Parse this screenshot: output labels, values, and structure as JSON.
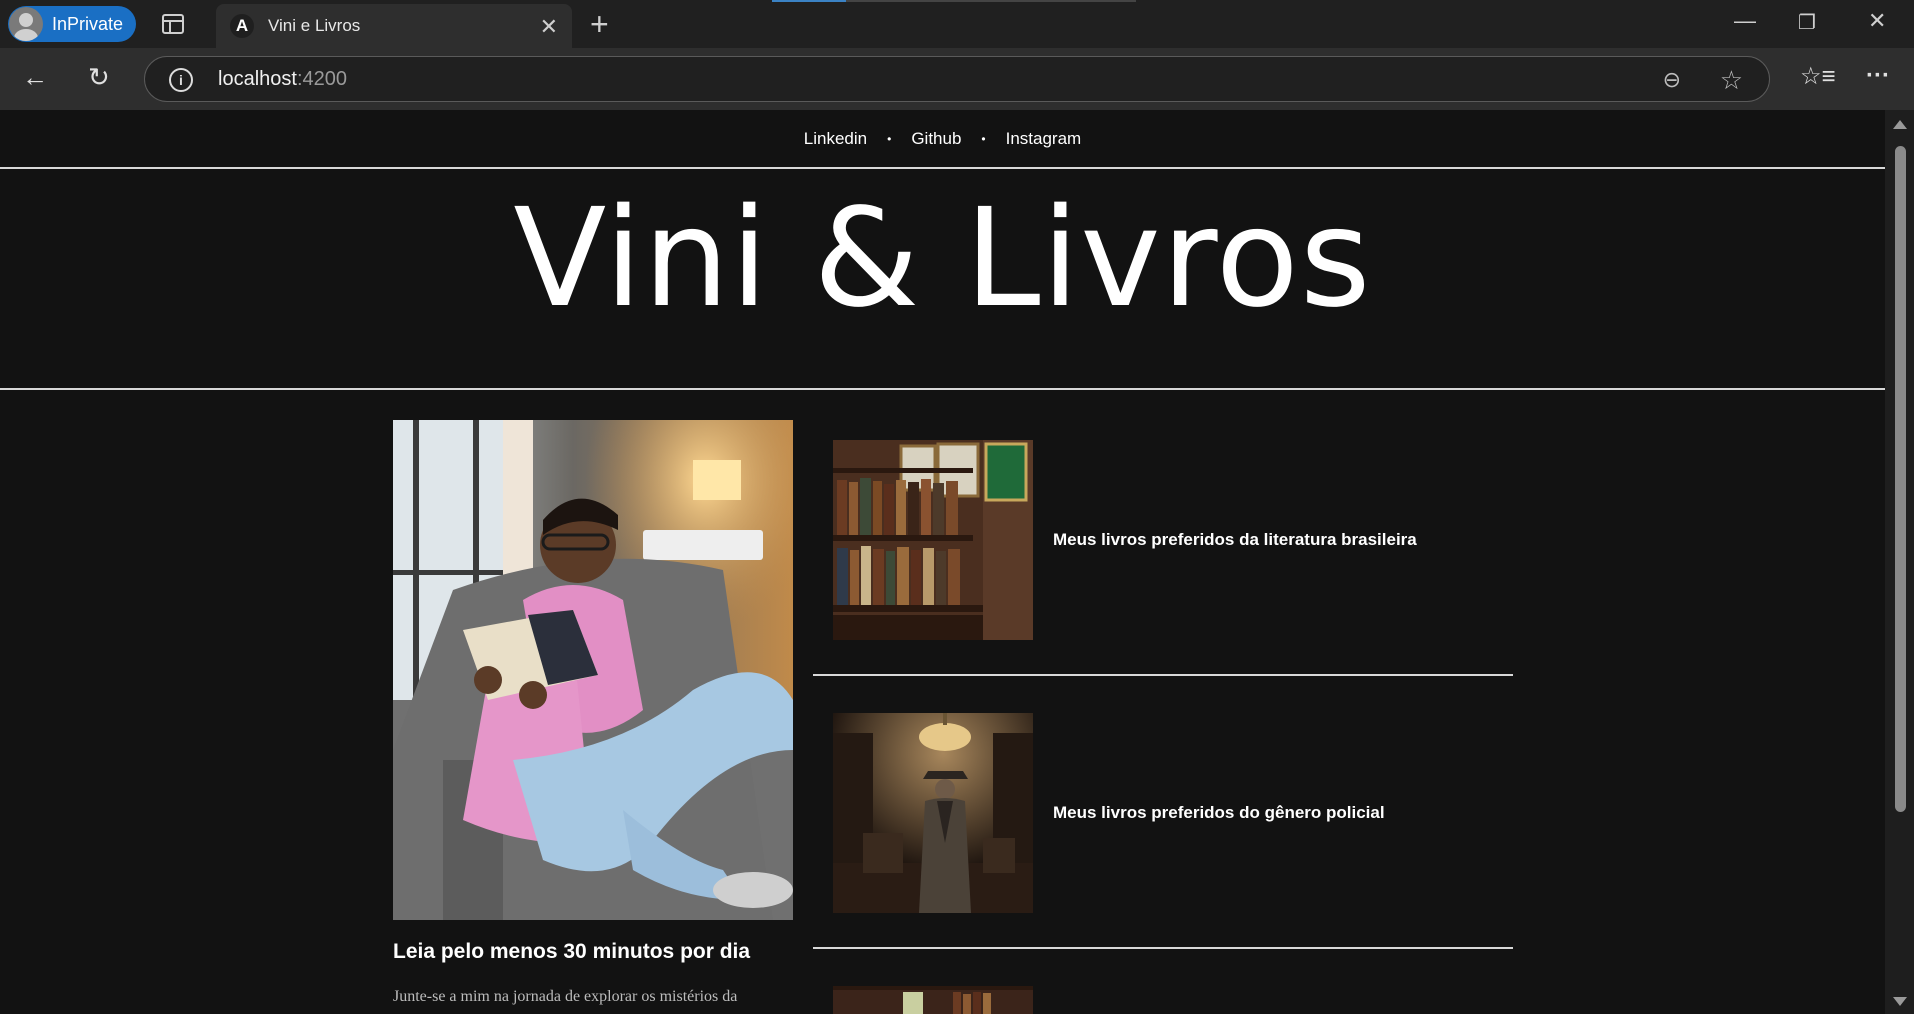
{
  "browser": {
    "profile_label": "InPrivate",
    "tab_title": "Vini e Livros",
    "tab_favicon": "A",
    "url_host": "localhost",
    "url_port": ":4200"
  },
  "site": {
    "social_links": [
      "Linkedin",
      "Github",
      "Instagram"
    ],
    "separator": "•",
    "brand_title": "Vini & Livros"
  },
  "featured": {
    "title": "Leia pelo menos 30 minutos por dia",
    "excerpt": "Junte-se a mim na jornada de explorar os mistérios da"
  },
  "posts": [
    {
      "title": "Meus livros preferidos da literatura brasileira"
    },
    {
      "title": "Meus livros preferidos do gênero policial"
    }
  ]
}
